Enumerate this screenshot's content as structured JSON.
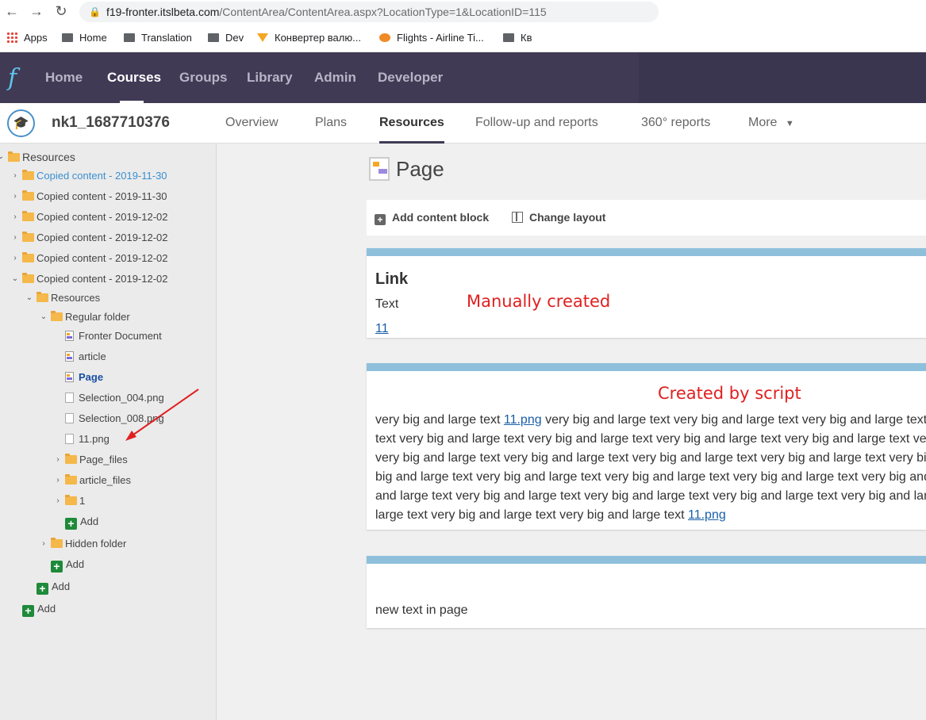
{
  "browser": {
    "url_host": "f19-fronter.itslbeta.com",
    "url_path": "/ContentArea/ContentArea.aspx?LocationType=1&LocationID=115",
    "bookmarks": [
      "Apps",
      "Home",
      "Translation",
      "Dev",
      "Конвертер валю...",
      "Flights - Airline Ti...",
      "Кв"
    ]
  },
  "topnav": {
    "items": [
      "Home",
      "Courses",
      "Groups",
      "Library",
      "Admin",
      "Developer"
    ],
    "active": "Courses"
  },
  "course": {
    "title": "nk1_1687710376",
    "tabs": [
      "Overview",
      "Plans",
      "Resources",
      "Follow-up and reports",
      "360° reports",
      "More"
    ],
    "active_tab": "Resources"
  },
  "tree": {
    "root": "Resources",
    "items": [
      "Copied content - 2019-11-30",
      "Copied content - 2019-11-30",
      "Copied content - 2019-12-02",
      "Copied content - 2019-12-02",
      "Copied content - 2019-12-02",
      "Copied content - 2019-12-02"
    ],
    "sub_resources": "Resources",
    "regular_folder": "Regular folder",
    "files": [
      "Fronter Document",
      "article",
      "Page",
      "Selection_004.png",
      "Selection_008.png",
      "11.png"
    ],
    "subfolders": [
      "Page_files",
      "article_files",
      "1"
    ],
    "hidden_folder": "Hidden folder",
    "add_label": "Add"
  },
  "main": {
    "page_title": "Page",
    "add_block": "Add content block",
    "change_layout": "Change layout",
    "block1": {
      "title": "Link",
      "text": "Text",
      "link": "11",
      "annotation": "Manually created"
    },
    "block2": {
      "annotation": "Created by script",
      "lines": [
        [
          "very big and large text ",
          "11.png",
          " very big and large text very big and large text very big and large text"
        ],
        [
          "text very big and large text very big and large text very big and large text very big and large text very big and large text"
        ],
        [
          "very big and large text very big and large text very big and large text very big and large text very big and large text"
        ],
        [
          "big and large text very big and large text very big and large text very big and large text very big and large text very big"
        ],
        [
          "and large text very big and large text very big and large text very big and large text very big and large text very big and"
        ],
        [
          "large text very big and large text very big and large text ",
          "11.png",
          ""
        ]
      ]
    },
    "block3": {
      "text": "new text in page"
    }
  }
}
